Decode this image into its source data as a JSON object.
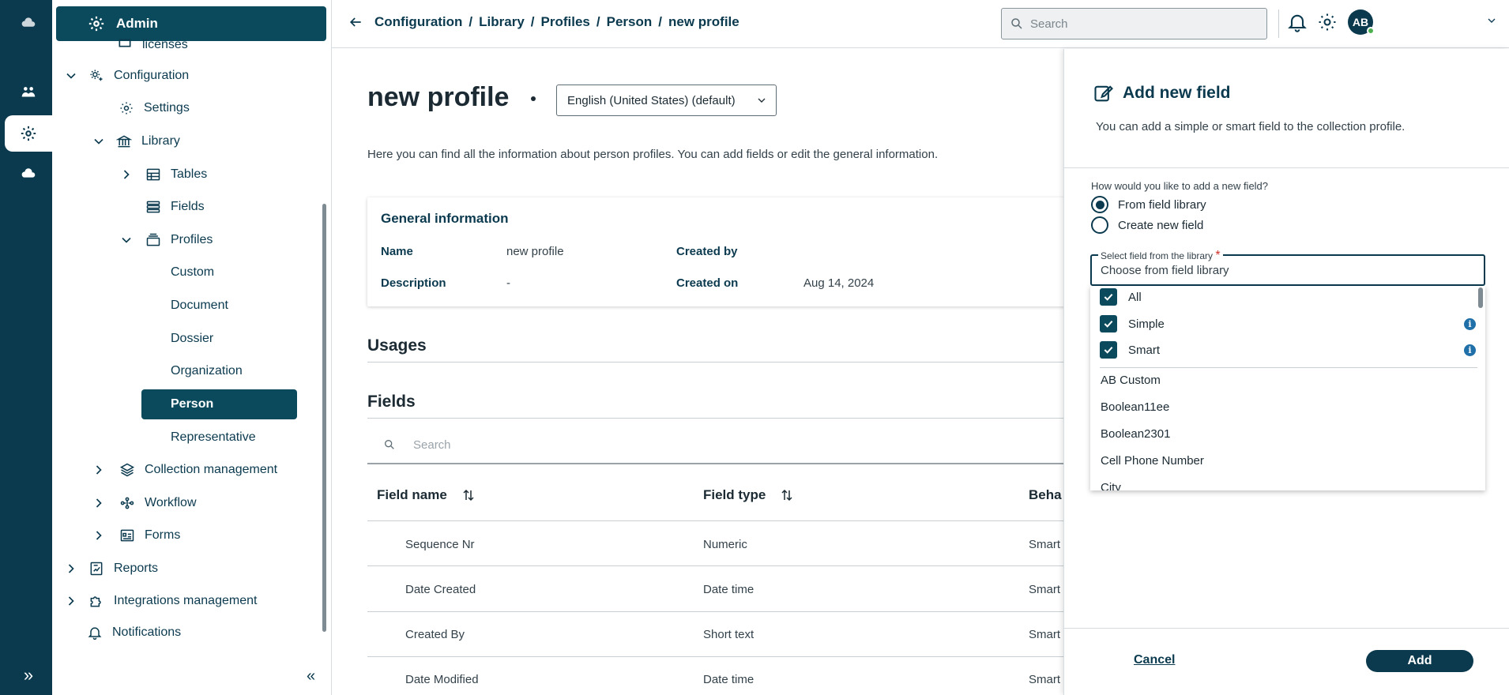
{
  "rail": {
    "items": [
      "cloud-icon",
      "people-icon",
      "settings-icon",
      "cloud-icon"
    ],
    "expand_label": "»"
  },
  "sidebar": {
    "admin_label": "Admin",
    "partial_item": "licenses",
    "configuration": "Configuration",
    "settings": "Settings",
    "library": "Library",
    "tables": "Tables",
    "fields": "Fields",
    "profiles": "Profiles",
    "profile_items": [
      "Custom",
      "Document",
      "Dossier",
      "Organization",
      "Person",
      "Representative"
    ],
    "collection_management": "Collection management",
    "workflow": "Workflow",
    "forms": "Forms",
    "reports": "Reports",
    "integrations_management": "Integrations management",
    "notifications": "Notifications",
    "collapse_label": "«"
  },
  "topbar": {
    "breadcrumb": [
      "Configuration",
      "Library",
      "Profiles",
      "Person",
      "new profile"
    ],
    "separator": "/",
    "search_placeholder": "Search",
    "avatar_initials": "AB"
  },
  "main": {
    "title": "new profile",
    "language": "English (United States) (default)",
    "description": "Here you can find all the information about person profiles. You can add fields or edit the general information.",
    "general_info": {
      "heading": "General information",
      "name_label": "Name",
      "name_value": "new profile",
      "description_label": "Description",
      "description_value": "-",
      "created_by_label": "Created by",
      "created_on_label": "Created on",
      "created_on_value": "Aug 14, 2024"
    },
    "usages_heading": "Usages",
    "fields_heading": "Fields",
    "fields_search_placeholder": "Search",
    "columns": [
      "Field name",
      "Field type",
      "Beha"
    ],
    "rows": [
      {
        "name": "Sequence Nr",
        "type": "Numeric",
        "behavior": "Smart"
      },
      {
        "name": "Date Created",
        "type": "Date time",
        "behavior": "Smart"
      },
      {
        "name": "Created By",
        "type": "Short text",
        "behavior": "Smart"
      },
      {
        "name": "Date Modified",
        "type": "Date time",
        "behavior": "Smart"
      }
    ]
  },
  "drawer": {
    "title": "Add new field",
    "subtitle": "You can add a simple or smart field to the collection profile.",
    "question": "How would you like to add a new field?",
    "option_library": "From field library",
    "option_create": "Create new field",
    "selected_option": "From field library",
    "select_label": "Select field from the library",
    "required_mark": "*",
    "select_placeholder": "Choose from field library",
    "filters": [
      "All",
      "Simple",
      "Smart"
    ],
    "info_glyph": "i",
    "options": [
      "AB Custom",
      "Boolean11ee",
      "Boolean2301",
      "Cell Phone Number",
      "City"
    ],
    "cancel_label": "Cancel",
    "add_label": "Add"
  }
}
